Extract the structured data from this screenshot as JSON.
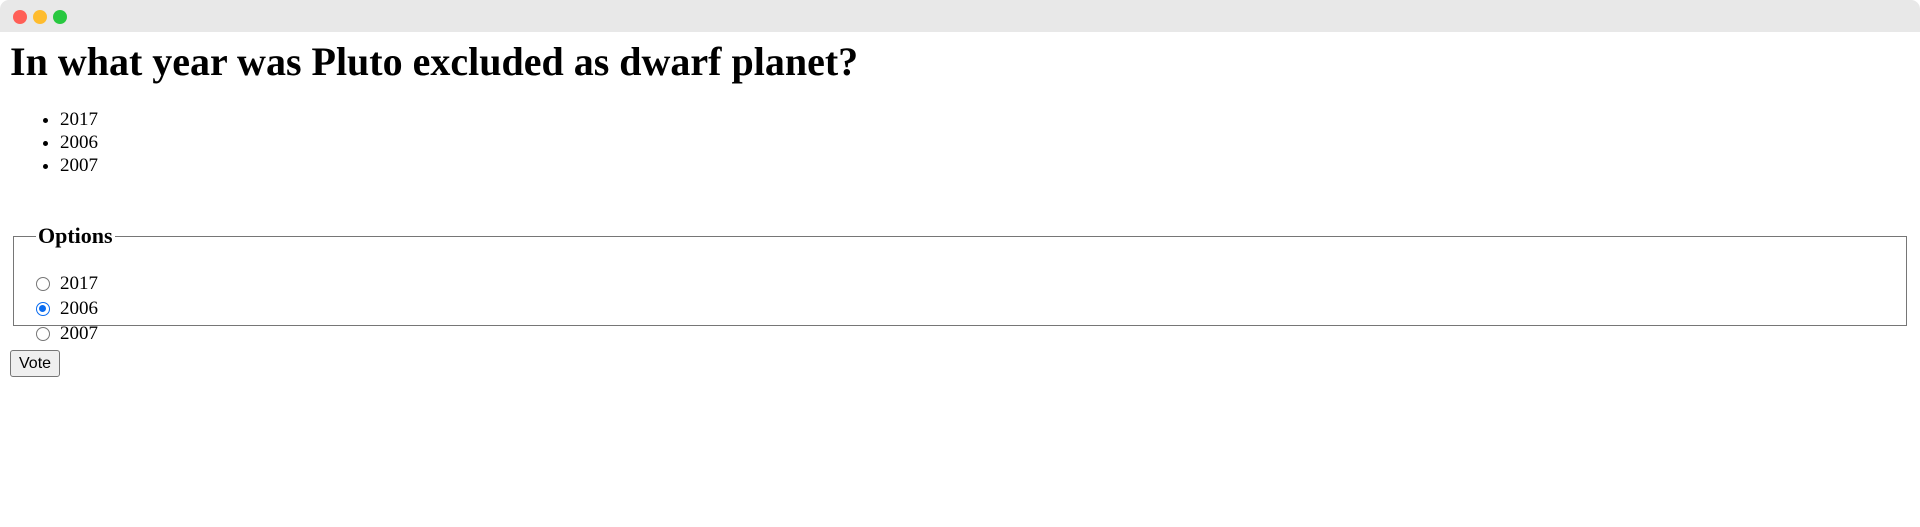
{
  "poll": {
    "question": "In what year was Pluto excluded as dwarf planet?",
    "answers": [
      "2017",
      "2006",
      "2007"
    ],
    "options_legend": "Options",
    "options": [
      {
        "label": "2017",
        "checked": false
      },
      {
        "label": "2006",
        "checked": true
      },
      {
        "label": "2007",
        "checked": false
      }
    ],
    "vote_label": "Vote"
  },
  "colors": {
    "accent": "#0a6cf0",
    "titlebar": "#e8e8e8"
  }
}
